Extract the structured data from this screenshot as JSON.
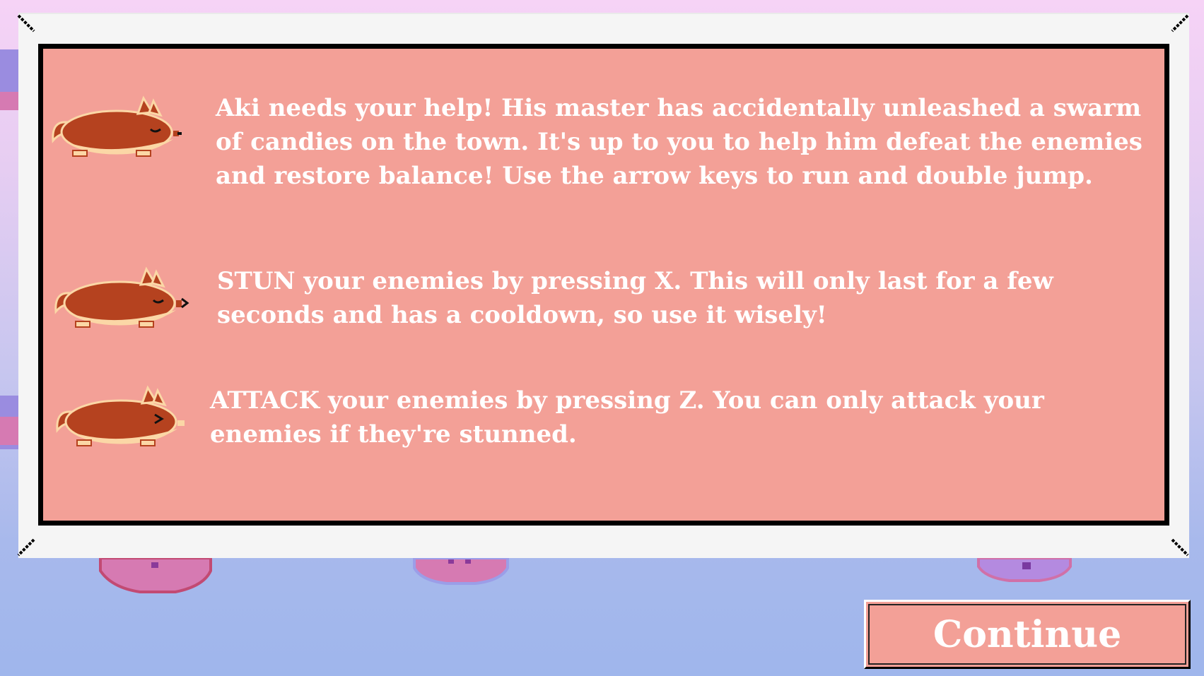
{
  "instructions": [
    {
      "text": "Aki needs your help! His master has accidentally unleashed a swarm of candies on the town. It's up to you to help him defeat the enemies and restore balance! Use the arrow keys to run and double jump.",
      "icon": "sleeping-dog-icon"
    },
    {
      "text": "STUN your enemies by pressing X. This will only last for a few seconds and has a cooldown, so use it wisely!",
      "icon": "barking-dog-icon"
    },
    {
      "text": "ATTACK your enemies by pressing Z. You can only attack your enemies if they're stunned.",
      "icon": "attacking-dog-icon"
    }
  ],
  "continue_button": {
    "label": "Continue"
  },
  "colors": {
    "panel": "#f3a097",
    "frame": "#f5f5f5",
    "dog_body": "#b5421f",
    "dog_belly": "#fbd7a6"
  }
}
